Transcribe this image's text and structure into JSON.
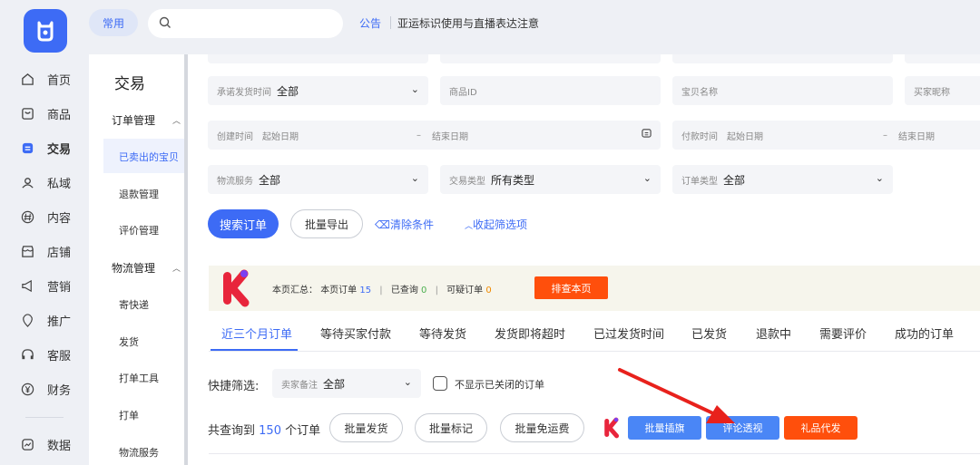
{
  "sidebar": {
    "items": [
      {
        "label": "首页",
        "icon": "home-icon"
      },
      {
        "label": "商品",
        "icon": "product-icon"
      },
      {
        "label": "交易",
        "icon": "trade-icon"
      },
      {
        "label": "私域",
        "icon": "users-icon"
      },
      {
        "label": "内容",
        "icon": "hash-icon"
      },
      {
        "label": "店铺",
        "icon": "shop-icon"
      },
      {
        "label": "营销",
        "icon": "megaphone-icon"
      },
      {
        "label": "推广",
        "icon": "pin-icon"
      },
      {
        "label": "客服",
        "icon": "headset-icon"
      },
      {
        "label": "财务",
        "icon": "yuan-icon"
      },
      {
        "label": "数据",
        "icon": "chart-icon"
      }
    ],
    "active": "交易"
  },
  "topbar": {
    "common_label": "常用",
    "search_placeholder": "",
    "notice_label": "公告",
    "notice_text": "亚运标识使用与直播表达注意"
  },
  "subnav": {
    "title": "交易",
    "groups": [
      {
        "label": "订单管理",
        "items": [
          "已卖出的宝贝",
          "退款管理",
          "评价管理"
        ]
      },
      {
        "label": "物流管理",
        "items": [
          "寄快递",
          "发货",
          "打单工具",
          "打单",
          "物流服务"
        ]
      }
    ],
    "active_item": "已卖出的宝贝"
  },
  "filters": {
    "promise_time": {
      "label": "承诺发货时间",
      "value": "全部"
    },
    "product_id": {
      "placeholder": "商品ID"
    },
    "item_name": {
      "placeholder": "宝贝名称"
    },
    "buyer_nick": {
      "placeholder": "买家昵称"
    },
    "create_time": {
      "label": "创建时间",
      "start": "起始日期",
      "sep": "–",
      "end": "结束日期"
    },
    "pay_time": {
      "label": "付款时间",
      "start": "起始日期",
      "sep": "–",
      "end": "结束日期"
    },
    "logistics": {
      "label": "物流服务",
      "value": "全部"
    },
    "trade_type": {
      "label": "交易类型",
      "value": "所有类型"
    },
    "order_type": {
      "label": "订单类型",
      "value": "全部"
    }
  },
  "actions": {
    "search": "搜索订单",
    "batch_export": "批量导出",
    "clear": "清除条件",
    "collapse": "收起筛选项"
  },
  "summary": {
    "prefix": "本页汇总：",
    "orders_label": "本页订单",
    "orders_count": "15",
    "queried_label": "已查询",
    "queried_count": "0",
    "suspicious_label": "可疑订单",
    "suspicious_count": "0",
    "check_button": "排查本页"
  },
  "tabs": [
    "近三个月订单",
    "等待买家付款",
    "等待发货",
    "发货即将超时",
    "已过发货时间",
    "已发货",
    "退款中",
    "需要评价",
    "成功的订单"
  ],
  "quick": {
    "label": "快捷筛选:",
    "seller_note_label": "卖家备注",
    "seller_note_value": "全部",
    "hide_closed": "不显示已关闭的订单"
  },
  "results": {
    "prefix": "共查询到",
    "count": "150",
    "suffix": "个订单",
    "batch_ship": "批量发货",
    "batch_mark": "批量标记",
    "batch_free_ship": "批量免运费",
    "batch_flag": "批量插旗",
    "review_insight": "评论透视",
    "gift": "礼品代发"
  },
  "colors": {
    "accent": "#3d6bf5",
    "orange": "#ff4f0c",
    "arrow": "#e8211c"
  }
}
